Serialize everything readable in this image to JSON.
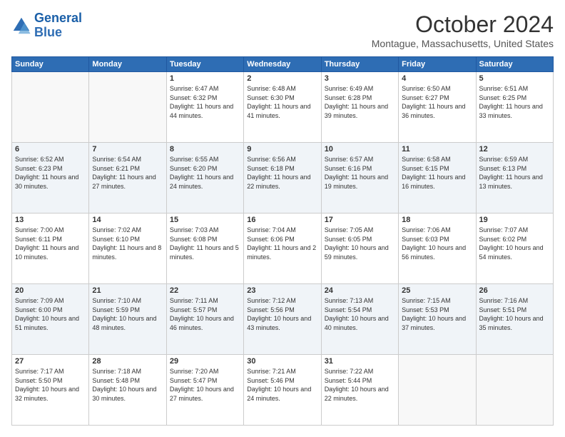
{
  "logo": {
    "name_line1": "General",
    "name_line2": "Blue"
  },
  "title": "October 2024",
  "location": "Montague, Massachusetts, United States",
  "days_of_week": [
    "Sunday",
    "Monday",
    "Tuesday",
    "Wednesday",
    "Thursday",
    "Friday",
    "Saturday"
  ],
  "weeks": [
    [
      {
        "day": "",
        "empty": true
      },
      {
        "day": "",
        "empty": true
      },
      {
        "day": "1",
        "sunrise": "6:47 AM",
        "sunset": "6:32 PM",
        "daylight": "11 hours and 44 minutes."
      },
      {
        "day": "2",
        "sunrise": "6:48 AM",
        "sunset": "6:30 PM",
        "daylight": "11 hours and 41 minutes."
      },
      {
        "day": "3",
        "sunrise": "6:49 AM",
        "sunset": "6:28 PM",
        "daylight": "11 hours and 39 minutes."
      },
      {
        "day": "4",
        "sunrise": "6:50 AM",
        "sunset": "6:27 PM",
        "daylight": "11 hours and 36 minutes."
      },
      {
        "day": "5",
        "sunrise": "6:51 AM",
        "sunset": "6:25 PM",
        "daylight": "11 hours and 33 minutes."
      }
    ],
    [
      {
        "day": "6",
        "sunrise": "6:52 AM",
        "sunset": "6:23 PM",
        "daylight": "11 hours and 30 minutes."
      },
      {
        "day": "7",
        "sunrise": "6:54 AM",
        "sunset": "6:21 PM",
        "daylight": "11 hours and 27 minutes."
      },
      {
        "day": "8",
        "sunrise": "6:55 AM",
        "sunset": "6:20 PM",
        "daylight": "11 hours and 24 minutes."
      },
      {
        "day": "9",
        "sunrise": "6:56 AM",
        "sunset": "6:18 PM",
        "daylight": "11 hours and 22 minutes."
      },
      {
        "day": "10",
        "sunrise": "6:57 AM",
        "sunset": "6:16 PM",
        "daylight": "11 hours and 19 minutes."
      },
      {
        "day": "11",
        "sunrise": "6:58 AM",
        "sunset": "6:15 PM",
        "daylight": "11 hours and 16 minutes."
      },
      {
        "day": "12",
        "sunrise": "6:59 AM",
        "sunset": "6:13 PM",
        "daylight": "11 hours and 13 minutes."
      }
    ],
    [
      {
        "day": "13",
        "sunrise": "7:00 AM",
        "sunset": "6:11 PM",
        "daylight": "11 hours and 10 minutes."
      },
      {
        "day": "14",
        "sunrise": "7:02 AM",
        "sunset": "6:10 PM",
        "daylight": "11 hours and 8 minutes."
      },
      {
        "day": "15",
        "sunrise": "7:03 AM",
        "sunset": "6:08 PM",
        "daylight": "11 hours and 5 minutes."
      },
      {
        "day": "16",
        "sunrise": "7:04 AM",
        "sunset": "6:06 PM",
        "daylight": "11 hours and 2 minutes."
      },
      {
        "day": "17",
        "sunrise": "7:05 AM",
        "sunset": "6:05 PM",
        "daylight": "10 hours and 59 minutes."
      },
      {
        "day": "18",
        "sunrise": "7:06 AM",
        "sunset": "6:03 PM",
        "daylight": "10 hours and 56 minutes."
      },
      {
        "day": "19",
        "sunrise": "7:07 AM",
        "sunset": "6:02 PM",
        "daylight": "10 hours and 54 minutes."
      }
    ],
    [
      {
        "day": "20",
        "sunrise": "7:09 AM",
        "sunset": "6:00 PM",
        "daylight": "10 hours and 51 minutes."
      },
      {
        "day": "21",
        "sunrise": "7:10 AM",
        "sunset": "5:59 PM",
        "daylight": "10 hours and 48 minutes."
      },
      {
        "day": "22",
        "sunrise": "7:11 AM",
        "sunset": "5:57 PM",
        "daylight": "10 hours and 46 minutes."
      },
      {
        "day": "23",
        "sunrise": "7:12 AM",
        "sunset": "5:56 PM",
        "daylight": "10 hours and 43 minutes."
      },
      {
        "day": "24",
        "sunrise": "7:13 AM",
        "sunset": "5:54 PM",
        "daylight": "10 hours and 40 minutes."
      },
      {
        "day": "25",
        "sunrise": "7:15 AM",
        "sunset": "5:53 PM",
        "daylight": "10 hours and 37 minutes."
      },
      {
        "day": "26",
        "sunrise": "7:16 AM",
        "sunset": "5:51 PM",
        "daylight": "10 hours and 35 minutes."
      }
    ],
    [
      {
        "day": "27",
        "sunrise": "7:17 AM",
        "sunset": "5:50 PM",
        "daylight": "10 hours and 32 minutes."
      },
      {
        "day": "28",
        "sunrise": "7:18 AM",
        "sunset": "5:48 PM",
        "daylight": "10 hours and 30 minutes."
      },
      {
        "day": "29",
        "sunrise": "7:20 AM",
        "sunset": "5:47 PM",
        "daylight": "10 hours and 27 minutes."
      },
      {
        "day": "30",
        "sunrise": "7:21 AM",
        "sunset": "5:46 PM",
        "daylight": "10 hours and 24 minutes."
      },
      {
        "day": "31",
        "sunrise": "7:22 AM",
        "sunset": "5:44 PM",
        "daylight": "10 hours and 22 minutes."
      },
      {
        "day": "",
        "empty": true
      },
      {
        "day": "",
        "empty": true
      }
    ]
  ]
}
